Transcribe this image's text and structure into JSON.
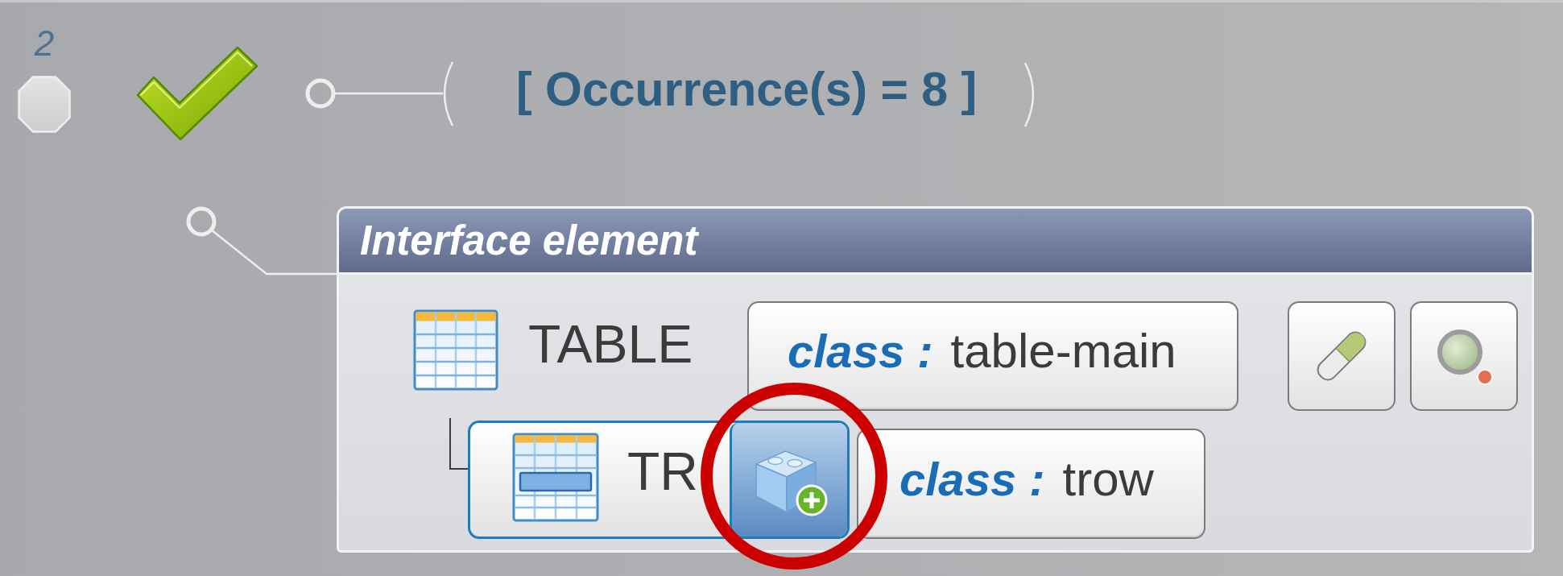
{
  "step": {
    "number": "2",
    "breakpoint": false,
    "passed": true
  },
  "occurrence": {
    "text": "[ Occurrence(s) = 8 ]"
  },
  "element_panel": {
    "title": "Interface element",
    "element": {
      "tag": "TABLE",
      "attribute": {
        "name": "class :",
        "value": "table-main"
      },
      "actions": [
        {
          "kind": "edit"
        },
        {
          "kind": "inspect"
        }
      ]
    },
    "child": {
      "tag": "TR",
      "add_button": {
        "highlighted": true
      },
      "attribute": {
        "name": "class :",
        "value": "trow"
      }
    }
  }
}
